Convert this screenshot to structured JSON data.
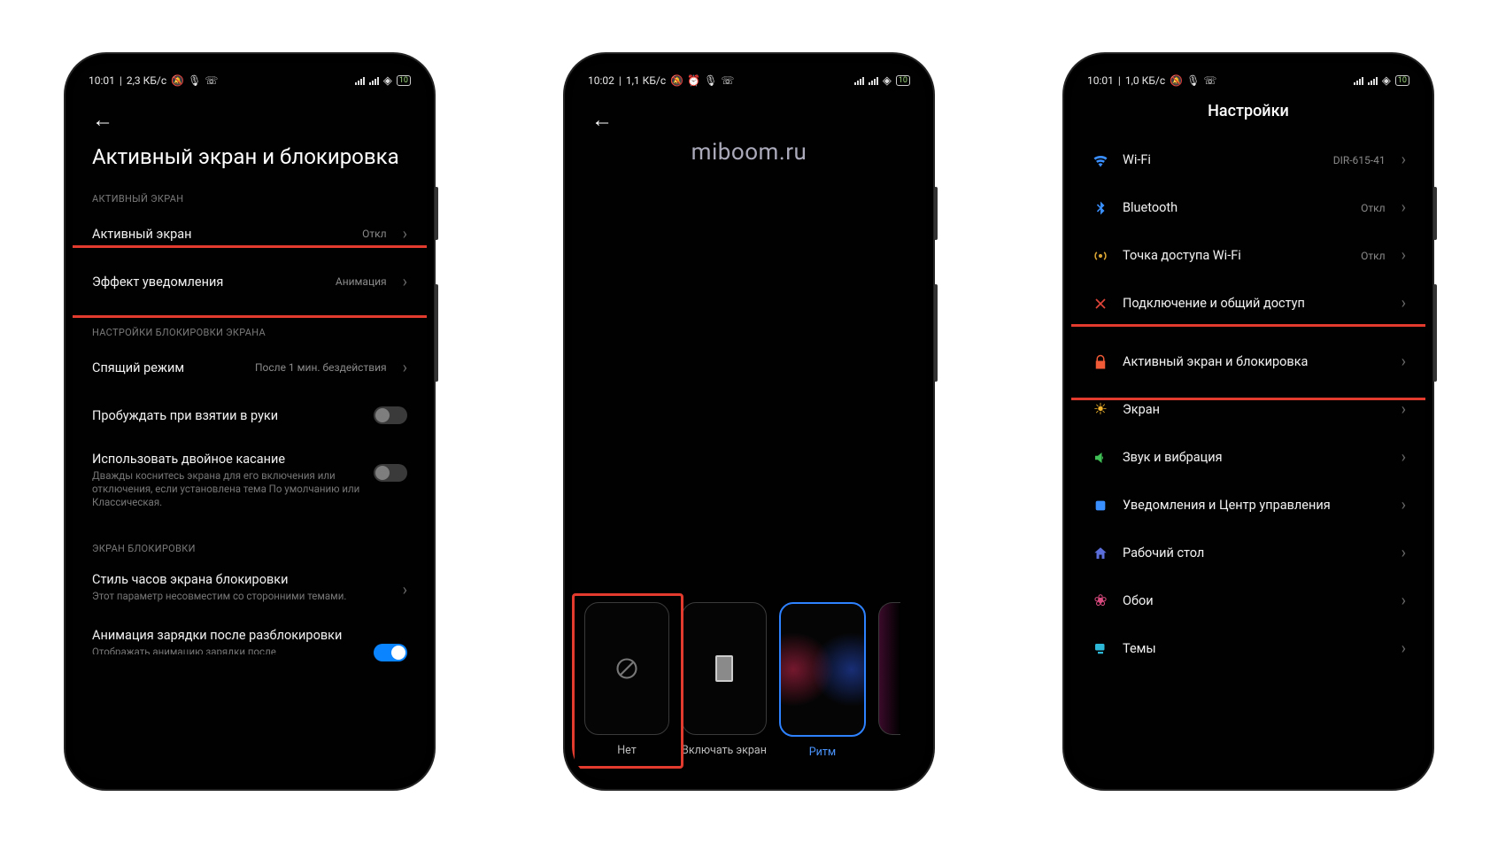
{
  "watermark": "miboom.ru",
  "phone1": {
    "status": {
      "time": "10:01",
      "rate": "2,3 КБ/с",
      "battery": "10"
    },
    "title": "Активный экран и блокировка",
    "section1": "АКТИВНЫЙ ЭКРАН",
    "row_active": {
      "label": "Активный экран",
      "value": "Откл"
    },
    "row_effect": {
      "label": "Эффект уведомления",
      "value": "Анимация"
    },
    "section2": "НАСТРОЙКИ БЛОКИРОВКИ ЭКРАНА",
    "row_sleep": {
      "label": "Спящий режим",
      "value": "После 1 мин. бездействия"
    },
    "row_raise": {
      "label": "Пробуждать при взятии в руки"
    },
    "row_dtap": {
      "label": "Использовать двойное касание",
      "sub": "Дважды коснитесь экрана для его включения или отключения, если установлена тема По умолчанию или Классическая."
    },
    "section3": "ЭКРАН БЛОКИРОВКИ",
    "row_clock": {
      "label": "Стиль часов экрана блокировки",
      "sub": "Этот параметр несовместим со сторонними темами."
    },
    "row_charge": {
      "label": "Анимация зарядки после разблокировки",
      "sub": "Отображать анимацию зарядки после"
    }
  },
  "phone2": {
    "status": {
      "time": "10:02",
      "rate": "1,1 КБ/с",
      "battery": "10"
    },
    "effects": [
      {
        "key": "none",
        "label": "Нет"
      },
      {
        "key": "wake",
        "label": "Включать экран"
      },
      {
        "key": "rhythm",
        "label": "Ритм"
      }
    ]
  },
  "phone3": {
    "status": {
      "time": "10:01",
      "rate": "1,0 КБ/с",
      "battery": "10"
    },
    "title": "Настройки",
    "items": [
      {
        "icon": "wifi",
        "label": "Wi-Fi",
        "value": "DIR-615-41"
      },
      {
        "icon": "bt",
        "label": "Bluetooth",
        "value": "Откл"
      },
      {
        "icon": "ap",
        "label": "Точка доступа Wi-Fi",
        "value": "Откл"
      },
      {
        "icon": "share",
        "label": "Подключение и общий доступ",
        "value": ""
      },
      {
        "icon": "lock",
        "label": "Активный экран и блокировка",
        "value": "",
        "hl": true
      },
      {
        "icon": "disp",
        "label": "Экран",
        "value": ""
      },
      {
        "icon": "snd",
        "label": "Звук и вибрация",
        "value": ""
      },
      {
        "icon": "noti",
        "label": "Уведомления и Центр управления",
        "value": ""
      },
      {
        "icon": "home",
        "label": "Рабочий стол",
        "value": ""
      },
      {
        "icon": "wall",
        "label": "Обои",
        "value": ""
      },
      {
        "icon": "theme",
        "label": "Темы",
        "value": ""
      }
    ]
  }
}
